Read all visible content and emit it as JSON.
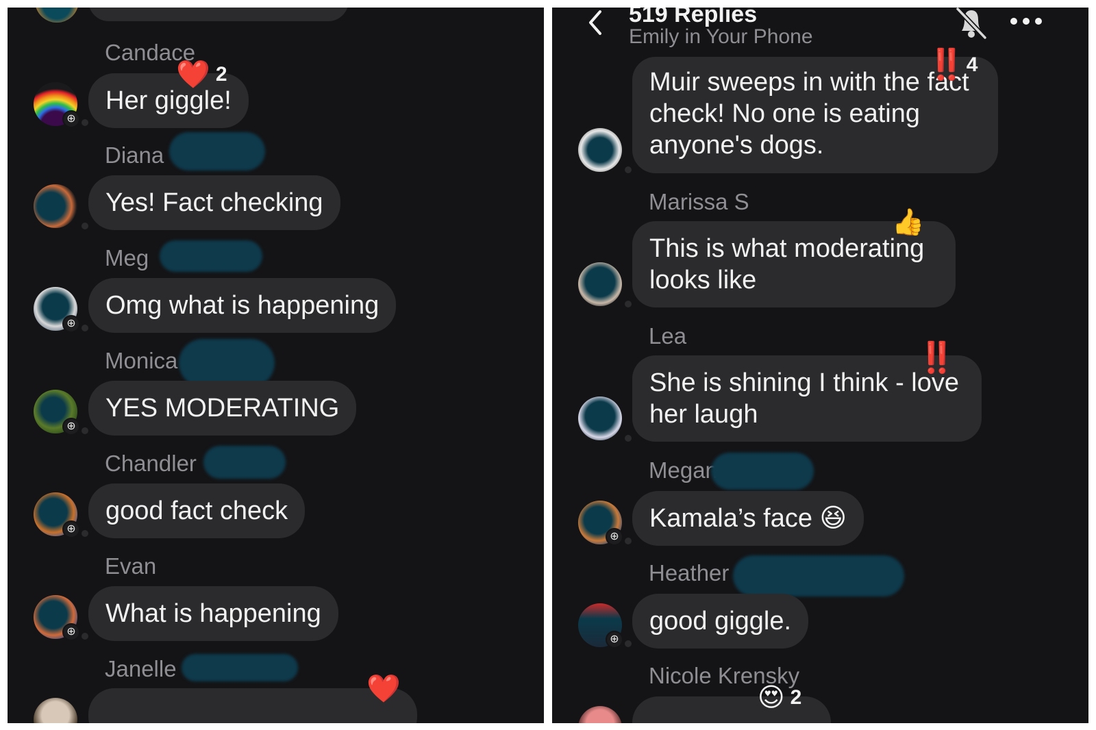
{
  "left": {
    "messages": [
      {
        "name": "Candace",
        "text": "Her giggle!",
        "reaction": {
          "emoji": "❤️",
          "count": "2"
        }
      },
      {
        "name": "Diana",
        "text": "Yes! Fact checking"
      },
      {
        "name": "Meg",
        "text": "Omg what is happening"
      },
      {
        "name": "Monica",
        "text": "YES MODERATING"
      },
      {
        "name": "Chandler",
        "text": "good fact check"
      },
      {
        "name": "Evan",
        "text": "What is happening"
      },
      {
        "name": "Janelle",
        "reaction": {
          "emoji": "❤️"
        }
      }
    ]
  },
  "right": {
    "header": {
      "title": "519 Replies",
      "subtitle": "Emily in Your Phone"
    },
    "messages": [
      {
        "text": "Muir sweeps in with the fact check! No one is eating anyone's dogs.",
        "reaction": {
          "emoji": "‼️",
          "count": "4"
        }
      },
      {
        "name": "Marissa S",
        "text": "This is what moderating looks like",
        "reaction": {
          "emoji": "👍"
        }
      },
      {
        "name": "Lea",
        "text": "She is shining I think - love her laugh",
        "reaction": {
          "emoji": "‼️"
        }
      },
      {
        "name": "Megan",
        "text": "Kamala’s face 😆"
      },
      {
        "name": "Heather",
        "text": "good giggle."
      },
      {
        "name": "Nicole Krensky",
        "reaction": {
          "emoji": "😍",
          "count": "2"
        }
      }
    ]
  },
  "colors": {
    "background": "#141416",
    "bubble": "#2b2b2e",
    "name": "#8e8e93",
    "text": "#f2f2f2",
    "redaction": "#0e3a4c",
    "reaction_red": "#e0202a"
  },
  "icons": [
    "back-chevron-icon",
    "bell-off-icon",
    "more-dots-icon",
    "avatar-badge-icon"
  ]
}
